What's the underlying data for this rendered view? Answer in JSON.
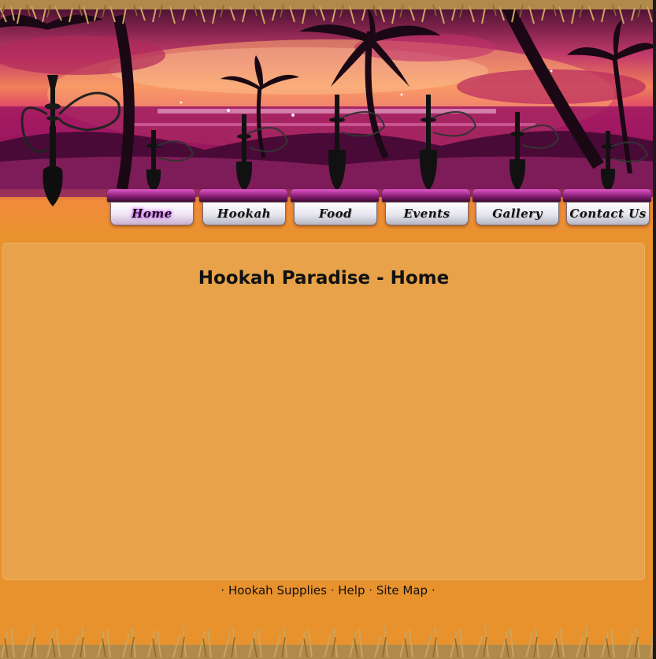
{
  "site": {
    "page_title": "Hookah Paradise - Home"
  },
  "nav": {
    "items": [
      {
        "label": "Home",
        "active": true
      },
      {
        "label": "Hookah",
        "active": false
      },
      {
        "label": "Food",
        "active": false
      },
      {
        "label": "Events",
        "active": false
      },
      {
        "label": "Gallery",
        "active": false
      },
      {
        "label": "Contact Us",
        "active": false
      }
    ]
  },
  "footer": {
    "links": [
      {
        "label": "Hookah Supplies"
      },
      {
        "label": "Help"
      },
      {
        "label": "Site Map"
      }
    ],
    "separator": "·"
  },
  "colors": {
    "background": "#e8922e",
    "content_panel": "#e7a24a",
    "nav_cap": "#8a1e78",
    "active_glow": "#d870ff"
  },
  "icons": [
    "hookah-icon",
    "palm-tree-icon",
    "grass-border"
  ]
}
